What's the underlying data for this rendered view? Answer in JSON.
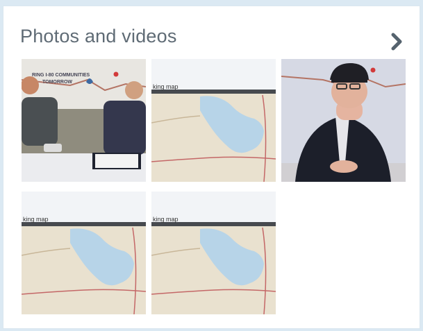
{
  "section": {
    "title": "Photos and videos"
  },
  "banner_text": {
    "line1": "RING I-80 COMMUNITIES",
    "line2": "TOMORROW"
  },
  "map_caption": "king map",
  "tiles": [
    {
      "kind": "photo-interview"
    },
    {
      "kind": "map-screenshot"
    },
    {
      "kind": "photo-presenter"
    },
    {
      "kind": "map-screenshot"
    },
    {
      "kind": "map-screenshot"
    }
  ],
  "colors": {
    "page_bg": "#dbe9f3",
    "title": "#5f6b75",
    "chevron": "#55636e",
    "map_land": "#e9e1cf",
    "map_water": "#b7d4e8"
  }
}
